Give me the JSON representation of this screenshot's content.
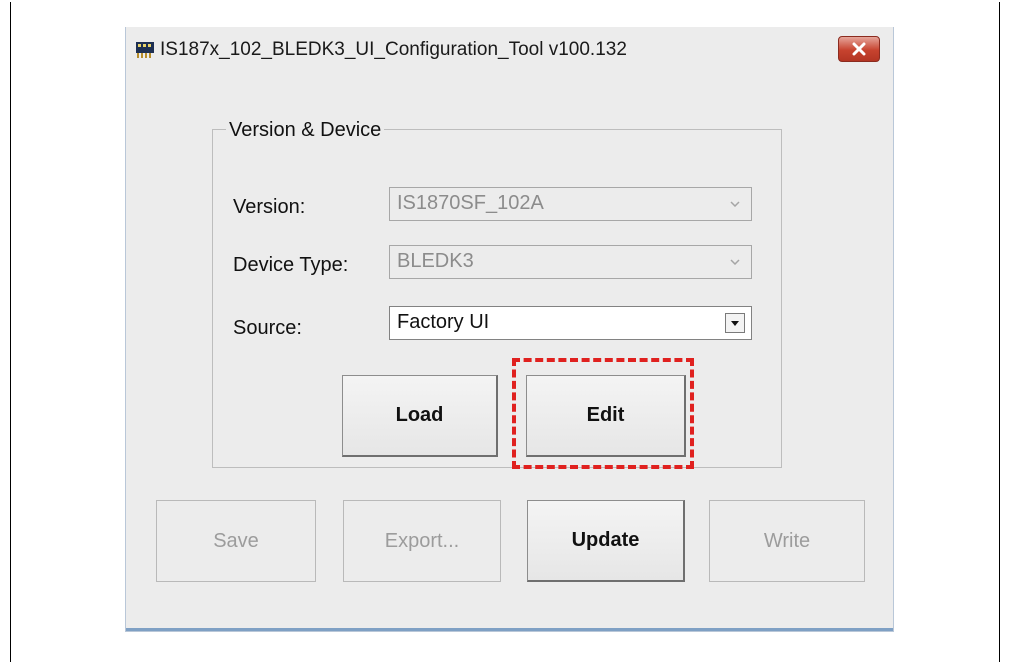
{
  "window": {
    "title": "IS187x_102_BLEDK3_UI_Configuration_Tool v100.132",
    "icon": "app-chip-icon",
    "close_icon": "close-icon",
    "close_color": "#c7432f"
  },
  "group": {
    "legend": "Version & Device"
  },
  "fields": {
    "version": {
      "label": "Version:",
      "value": "IS1870SF_102A",
      "enabled": false
    },
    "device_type": {
      "label": "Device Type:",
      "value": "BLEDK3",
      "enabled": false
    },
    "source": {
      "label": "Source:",
      "value": "Factory UI",
      "enabled": true
    }
  },
  "buttons": {
    "load": "Load",
    "edit": "Edit",
    "save": "Save",
    "export": "Export...",
    "update": "Update",
    "write": "Write"
  },
  "highlight": {
    "color": "#e0211f",
    "target": "Edit"
  }
}
